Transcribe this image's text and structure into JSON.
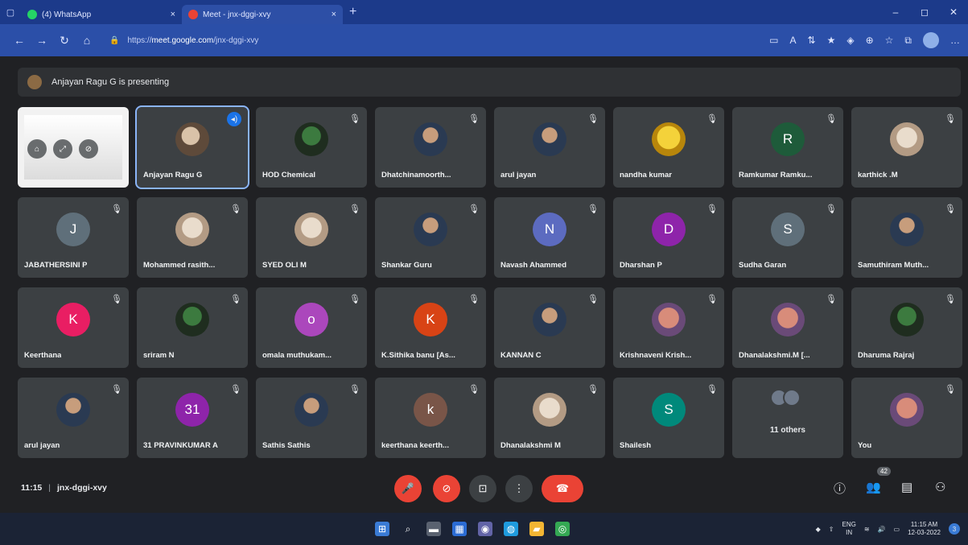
{
  "browser": {
    "tabs": [
      {
        "title": "(4) WhatsApp",
        "close": "×",
        "favicon_color": "#25d366"
      },
      {
        "title": "Meet - jnx-dggi-xvy",
        "close": "×",
        "favicon_color": "#ea4335"
      }
    ],
    "new_tab": "+",
    "window_controls": [
      "–",
      "◻",
      "✕"
    ],
    "nav": {
      "back": "←",
      "forward": "→",
      "reload": "↻",
      "home": "⌂"
    },
    "url_scheme": "https://",
    "url_host": "meet.google.com",
    "url_path": "/jnx-dggi-xvy",
    "toolbar_icons": [
      "▭",
      "A",
      "⇅",
      "★",
      "◈",
      "⊕",
      "☆",
      "⧉",
      "…"
    ]
  },
  "meet": {
    "presenter_banner": "Anjayan Ragu G is presenting",
    "participants": [
      {
        "name": "",
        "type": "screen"
      },
      {
        "name": "Anjayan Ragu G",
        "avatar_type": "photo",
        "speaking": true
      },
      {
        "name": "HOD Chemical",
        "avatar_type": "photo4"
      },
      {
        "name": "Dhatchinamoorth...",
        "avatar_type": "photo2"
      },
      {
        "name": "arul jayan",
        "avatar_type": "photo2"
      },
      {
        "name": "nandha kumar",
        "avatar_type": "photo3"
      },
      {
        "name": "Ramkumar Ramku...",
        "initial": "R",
        "color": "#1e5b3a"
      },
      {
        "name": "karthick .M",
        "avatar_type": "photo5"
      },
      {
        "name": "JABATHERSINI P",
        "initial": "J",
        "color": "#5f6f7a"
      },
      {
        "name": "Mohammed rasith...",
        "avatar_type": "photo5"
      },
      {
        "name": "SYED OLI M",
        "avatar_type": "photo5"
      },
      {
        "name": "Shankar Guru",
        "avatar_type": "photo2"
      },
      {
        "name": "Navash Ahammed",
        "initial": "N",
        "color": "#5c6bc0"
      },
      {
        "name": "Dharshan P",
        "initial": "D",
        "color": "#8e24aa"
      },
      {
        "name": "Sudha Garan",
        "initial": "S",
        "color": "#5f6f7a"
      },
      {
        "name": "Samuthiram Muth...",
        "avatar_type": "photo2"
      },
      {
        "name": "Keerthana",
        "initial": "K",
        "color": "#e91e63"
      },
      {
        "name": "sriram N",
        "avatar_type": "photo4"
      },
      {
        "name": "omala muthukam...",
        "initial": "o",
        "color": "#ab47bc"
      },
      {
        "name": "K.Sithika banu [As...",
        "initial": "K",
        "color": "#d84315"
      },
      {
        "name": "KANNAN C",
        "avatar_type": "photo2"
      },
      {
        "name": "Krishnaveni Krish...",
        "avatar_type": "photo6"
      },
      {
        "name": "Dhanalakshmi.M [...",
        "avatar_type": "photo6"
      },
      {
        "name": "Dharuma Rajraj",
        "avatar_type": "photo4"
      },
      {
        "name": "arul jayan",
        "avatar_type": "photo2"
      },
      {
        "name": "31 PRAVINKUMAR A",
        "initial": "31",
        "color": "#8e24aa"
      },
      {
        "name": "Sathis Sathis",
        "avatar_type": "photo2"
      },
      {
        "name": "keerthana keerth...",
        "initial": "k",
        "color": "#795548"
      },
      {
        "name": "Dhanalakshmi M",
        "avatar_type": "photo5"
      },
      {
        "name": "Shailesh",
        "initial": "S",
        "color": "#00897b"
      },
      {
        "name": "11 others",
        "type": "others"
      },
      {
        "name": "You",
        "avatar_type": "photo6"
      }
    ],
    "mic_off_glyph": "🎙",
    "speaking_glyph": "◂)",
    "screen_controls": [
      "⌂",
      "⤢",
      "⊘"
    ],
    "meeting_time": "11:15",
    "meeting_separator": "|",
    "meeting_code": "jnx-dggi-xvy",
    "controls": {
      "mic": "🎤",
      "camera": "⊘",
      "present": "⊡",
      "more": "⋮",
      "end_call": "☎"
    },
    "right_controls": {
      "info": "ⓘ",
      "people": "👥",
      "people_count": "42",
      "chat": "▤",
      "activities": "⚇"
    }
  },
  "taskbar": {
    "icons": [
      "⊞",
      "⌕",
      "▬",
      "▦",
      "◉",
      "◍",
      "▰",
      "◎"
    ],
    "language": "ENG",
    "language_sub": "IN",
    "time": "11:15 AM",
    "date": "12-03-2022",
    "tray_icons": [
      "◆",
      "⇧",
      "≋",
      "🔊",
      "▭"
    ],
    "notification": "3"
  },
  "colors": {
    "chrome_tabbar": "#1c3a8a",
    "meet_bg": "#202124",
    "tile_bg": "#3c4043",
    "danger": "#ea4335",
    "accent": "#8ab4f8"
  }
}
